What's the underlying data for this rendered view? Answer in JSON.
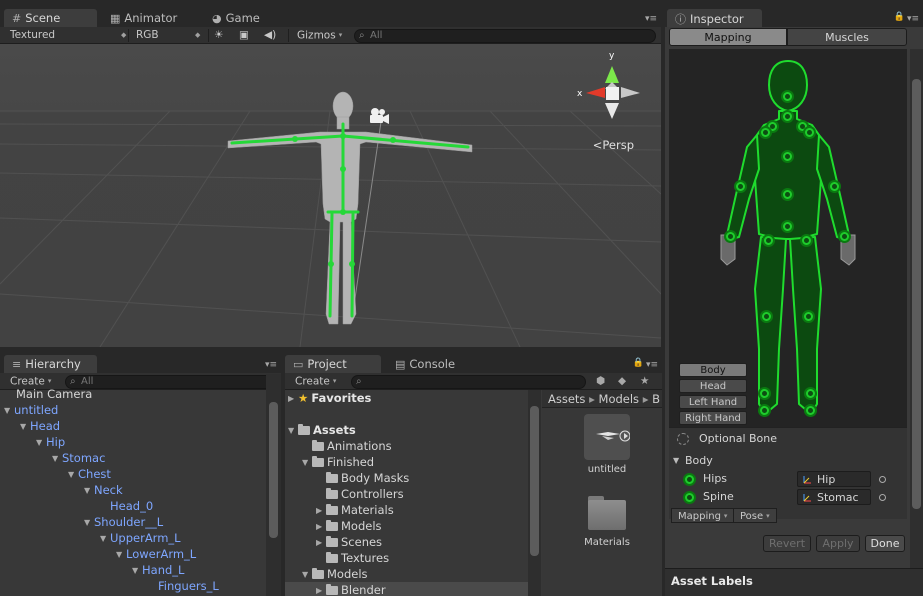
{
  "scene_panel": {
    "tabs": [
      {
        "label": "Scene",
        "icon": "grid-icon"
      },
      {
        "label": "Animator",
        "icon": "animator-icon"
      },
      {
        "label": "Game",
        "icon": "pacman-icon"
      }
    ],
    "toolbar": {
      "draw_mode": "Textured",
      "render_mode": "RGB",
      "gizmos_label": "Gizmos",
      "search_placeholder": "All"
    },
    "persp_label": "Persp",
    "gizmo_axes": {
      "y": "y",
      "x": "x"
    }
  },
  "hierarchy_panel": {
    "tab_label": "Hierarchy",
    "create_label": "Create",
    "search_placeholder": "All",
    "items": [
      {
        "label": "Main Camera",
        "depth": 0,
        "expanded": null,
        "style": "plain"
      },
      {
        "label": "untitled",
        "depth": 0,
        "expanded": true,
        "style": "prefab"
      },
      {
        "label": "Head",
        "depth": 1,
        "expanded": true,
        "style": "prefab"
      },
      {
        "label": "Hip",
        "depth": 2,
        "expanded": true,
        "style": "prefab"
      },
      {
        "label": "Stomac",
        "depth": 3,
        "expanded": true,
        "style": "prefab"
      },
      {
        "label": "Chest",
        "depth": 4,
        "expanded": true,
        "style": "prefab"
      },
      {
        "label": "Neck",
        "depth": 5,
        "expanded": true,
        "style": "prefab"
      },
      {
        "label": "Head_0",
        "depth": 6,
        "expanded": null,
        "style": "prefab"
      },
      {
        "label": "Shoulder__L",
        "depth": 5,
        "expanded": true,
        "style": "prefab"
      },
      {
        "label": "UpperArm_L",
        "depth": 6,
        "expanded": true,
        "style": "prefab"
      },
      {
        "label": "LowerArm_L",
        "depth": 7,
        "expanded": true,
        "style": "prefab"
      },
      {
        "label": "Hand_L",
        "depth": 8,
        "expanded": true,
        "style": "prefab"
      },
      {
        "label": "Finguers_L",
        "depth": 9,
        "expanded": null,
        "style": "prefab"
      }
    ]
  },
  "project_panel": {
    "tabs": [
      {
        "label": "Project",
        "icon": "folder-icon"
      },
      {
        "label": "Console",
        "icon": "console-icon"
      }
    ],
    "create_label": "Create",
    "tree": [
      {
        "label": "Favorites",
        "depth": 0,
        "bold": true,
        "icon": "star-icon",
        "expanded": false
      },
      {
        "label": "Assets",
        "depth": 0,
        "bold": true,
        "icon": "folder-icon",
        "expanded": true
      },
      {
        "label": "Animations",
        "depth": 1,
        "icon": "folder-icon",
        "expanded": null
      },
      {
        "label": "Finished",
        "depth": 1,
        "icon": "folder-icon",
        "expanded": true
      },
      {
        "label": "Body Masks",
        "depth": 2,
        "icon": "folder-icon",
        "expanded": null
      },
      {
        "label": "Controllers",
        "depth": 2,
        "icon": "folder-icon",
        "expanded": null
      },
      {
        "label": "Materials",
        "depth": 2,
        "icon": "folder-icon",
        "expanded": false
      },
      {
        "label": "Models",
        "depth": 2,
        "icon": "folder-icon",
        "expanded": false
      },
      {
        "label": "Scenes",
        "depth": 2,
        "icon": "folder-icon",
        "expanded": false
      },
      {
        "label": "Textures",
        "depth": 2,
        "icon": "folder-icon",
        "expanded": null
      },
      {
        "label": "Models",
        "depth": 1,
        "icon": "folder-icon",
        "expanded": true
      },
      {
        "label": "Blender",
        "depth": 2,
        "icon": "folder-icon",
        "expanded": false,
        "selected": true
      }
    ],
    "breadcrumb": [
      "Assets",
      "Models",
      "B"
    ],
    "assets": [
      {
        "label": "untitled",
        "icon": "model-icon"
      },
      {
        "label": "Materials",
        "icon": "folder-icon"
      }
    ]
  },
  "inspector_panel": {
    "tab_label": "Inspector",
    "mode_tabs": [
      "Mapping",
      "Muscles"
    ],
    "active_mode": "Mapping",
    "part_buttons": [
      "Body",
      "Head",
      "Left Hand",
      "Right Hand"
    ],
    "active_part": "Body",
    "optional_bone_label": "Optional Bone",
    "section_label": "Body",
    "bones": [
      {
        "name": "Hips",
        "value": "Hip"
      },
      {
        "name": "Spine",
        "value": "Stomac"
      }
    ],
    "mapping_dropdown": "Mapping",
    "pose_dropdown": "Pose",
    "actions": {
      "revert": "Revert",
      "apply": "Apply",
      "done": "Done"
    },
    "asset_labels": "Asset Labels"
  },
  "colors": {
    "bone_green": "#1fcc2c",
    "prefab_blue": "#7ea6ff",
    "panel_bg": "#383838"
  }
}
